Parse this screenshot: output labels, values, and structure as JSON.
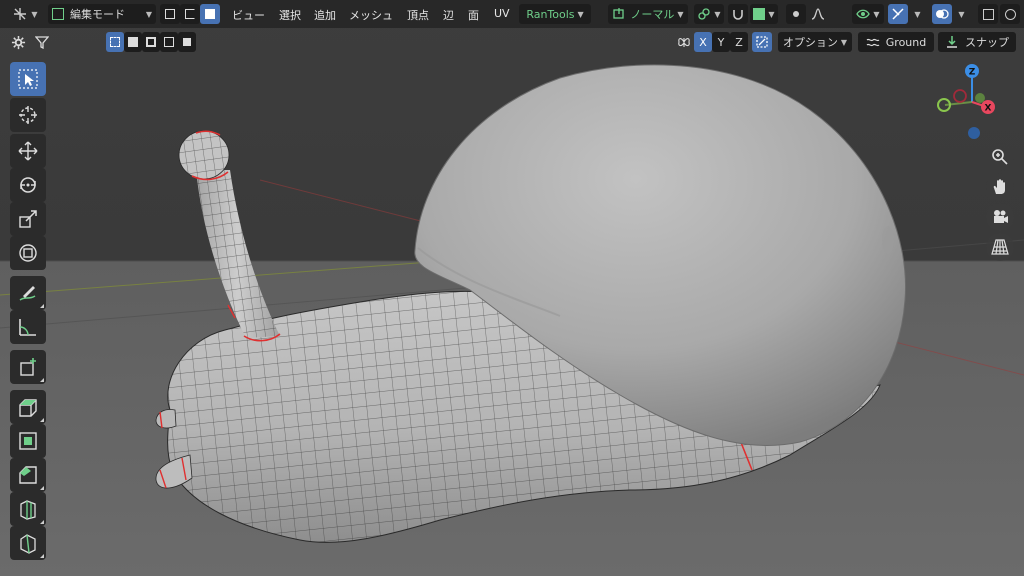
{
  "header": {
    "mode_label": "編集モード",
    "menus": [
      "ビュー",
      "選択",
      "追加",
      "メッシュ",
      "頂点",
      "辺",
      "面",
      "UV"
    ],
    "addon_label": "RanTools",
    "orientation_label": "ノーマル"
  },
  "toolhdr": {
    "axis_x": "X",
    "axis_y": "Y",
    "axis_z": "Z",
    "options_label": "オプション",
    "ground_label": "Ground",
    "snap_label": "スナップ"
  },
  "gizmo": {
    "z": "Z",
    "x": "X",
    "y": "Y"
  },
  "colors": {
    "accent": "#4772b3",
    "x_axis": "#e8475e",
    "y_axis": "#8ac64d",
    "z_axis": "#3b8ee6",
    "seam": "#e03030"
  },
  "toolbar_tools": [
    "select-box-icon",
    "cursor-icon",
    "move-icon",
    "rotate-icon",
    "scale-icon",
    "transform-icon",
    "annotate-icon",
    "measure-icon",
    "add-cube-icon",
    "extrude-icon",
    "inset-icon",
    "bevel-icon",
    "loop-cut-icon",
    "knife-icon"
  ]
}
